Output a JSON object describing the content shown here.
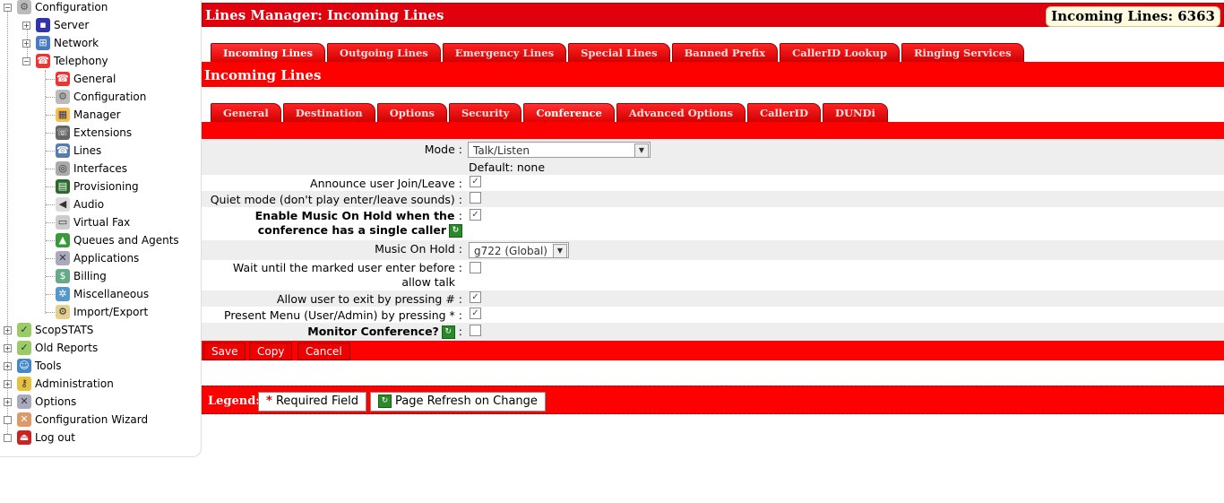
{
  "sidebar": {
    "root": "Configuration",
    "server": "Server",
    "network": "Network",
    "telephony": "Telephony",
    "children": [
      "General",
      "Configuration",
      "Manager",
      "Extensions",
      "Lines",
      "Interfaces",
      "Provisioning",
      "Audio",
      "Virtual Fax",
      "Queues and Agents",
      "Applications",
      "Billing",
      "Miscellaneous",
      "Import/Export"
    ],
    "bottom": [
      "ScopSTATS",
      "Old Reports",
      "Tools",
      "Administration",
      "Options",
      "Configuration Wizard",
      "Log out"
    ]
  },
  "header": {
    "title": "Lines Manager:  Incoming Lines",
    "count": "Incoming Lines: 6363"
  },
  "main_tabs": [
    "Incoming Lines",
    "Outgoing Lines",
    "Emergency Lines",
    "Special Lines",
    "Banned Prefix",
    "CallerID Lookup",
    "Ringing Services"
  ],
  "section_title": "Incoming Lines",
  "sub_tabs": [
    "General",
    "Destination",
    "Options",
    "Security",
    "Conference",
    "Advanced Options",
    "CallerID",
    "DUNDi"
  ],
  "form": {
    "mode_label": "Mode :",
    "mode_value": "Talk/Listen",
    "mode_default": "Default: none",
    "announce_label": "Announce user Join/Leave :",
    "quiet_label": "Quiet mode (don't play enter/leave sounds) :",
    "moh_single_line1": "Enable Music On Hold when the",
    "moh_single_line2": "conference has a single caller",
    "moh_label": "Music On Hold :",
    "moh_value": "g722 (Global)",
    "wait_line1": "Wait until the marked user enter before",
    "wait_line2": "allow talk",
    "exit_label": "Allow user to exit by pressing # :",
    "menu_label": "Present Menu (User/Admin) by pressing * :",
    "monitor_label": "Monitor Conference?",
    "colon": ":",
    "announce_checked": true,
    "quiet_checked": false,
    "moh_single_checked": true,
    "wait_checked": false,
    "exit_checked": true,
    "menu_checked": true,
    "monitor_checked": false
  },
  "buttons": {
    "save": "Save",
    "copy": "Copy",
    "cancel": "Cancel"
  },
  "legend": {
    "title": "Legend:",
    "required_mark": "*",
    "required": "Required Field",
    "refresh": "Page Refresh on Change"
  },
  "colors": {
    "accent": "#e0000e",
    "bar": "#ff0000"
  },
  "icons": {
    "refresh": "refresh-icon",
    "checkmark": "✓",
    "dropdown": "▼"
  }
}
